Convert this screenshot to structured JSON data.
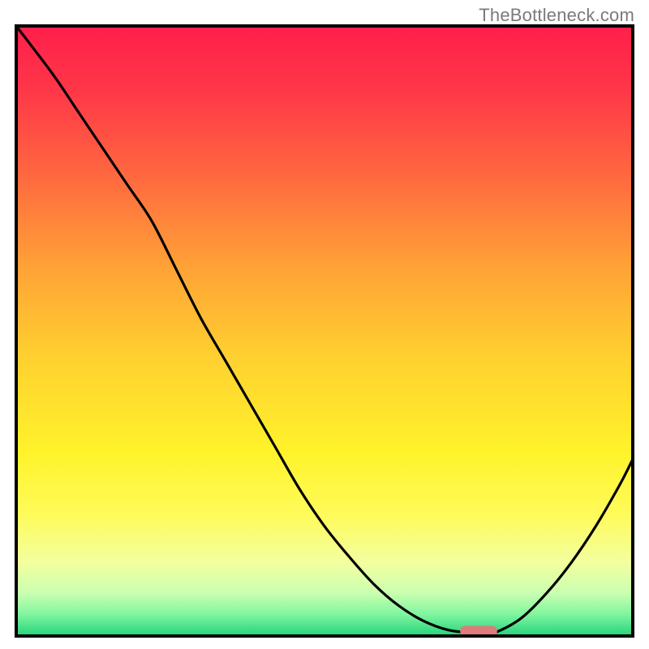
{
  "watermark": "TheBottleneck.com",
  "chart_data": {
    "type": "line",
    "title": "",
    "xlabel": "",
    "ylabel": "",
    "xlim": [
      0,
      100
    ],
    "ylim": [
      0,
      100
    ],
    "grid": false,
    "legend": false,
    "series": [
      {
        "name": "curve",
        "x": [
          0,
          6,
          10,
          14,
          18,
          22,
          26,
          30,
          34,
          38,
          42,
          46,
          50,
          54,
          58,
          62,
          66,
          70,
          74,
          76,
          78,
          82,
          86,
          90,
          94,
          98,
          100
        ],
        "y": [
          100,
          92,
          86,
          80,
          74,
          68,
          60,
          52,
          45,
          38,
          31,
          24,
          18,
          13,
          8.5,
          5,
          2.5,
          1,
          0.5,
          0.5,
          0.7,
          3,
          7,
          12,
          18,
          25,
          29
        ]
      }
    ],
    "marker": {
      "x_center": 75,
      "y": 0.8,
      "width_x": 6,
      "color": "#de7b7b"
    },
    "gradient_stops": [
      {
        "offset": 0.0,
        "color": "#ff1f4b"
      },
      {
        "offset": 0.1,
        "color": "#ff3548"
      },
      {
        "offset": 0.25,
        "color": "#ff6a3f"
      },
      {
        "offset": 0.4,
        "color": "#ffa436"
      },
      {
        "offset": 0.55,
        "color": "#ffd22f"
      },
      {
        "offset": 0.7,
        "color": "#fff32b"
      },
      {
        "offset": 0.8,
        "color": "#fffb5a"
      },
      {
        "offset": 0.88,
        "color": "#f3ffa0"
      },
      {
        "offset": 0.93,
        "color": "#c9ffb0"
      },
      {
        "offset": 0.965,
        "color": "#7ff59f"
      },
      {
        "offset": 1.0,
        "color": "#23d37a"
      }
    ],
    "frame": {
      "stroke": "#000000",
      "stroke_width": 4
    }
  }
}
